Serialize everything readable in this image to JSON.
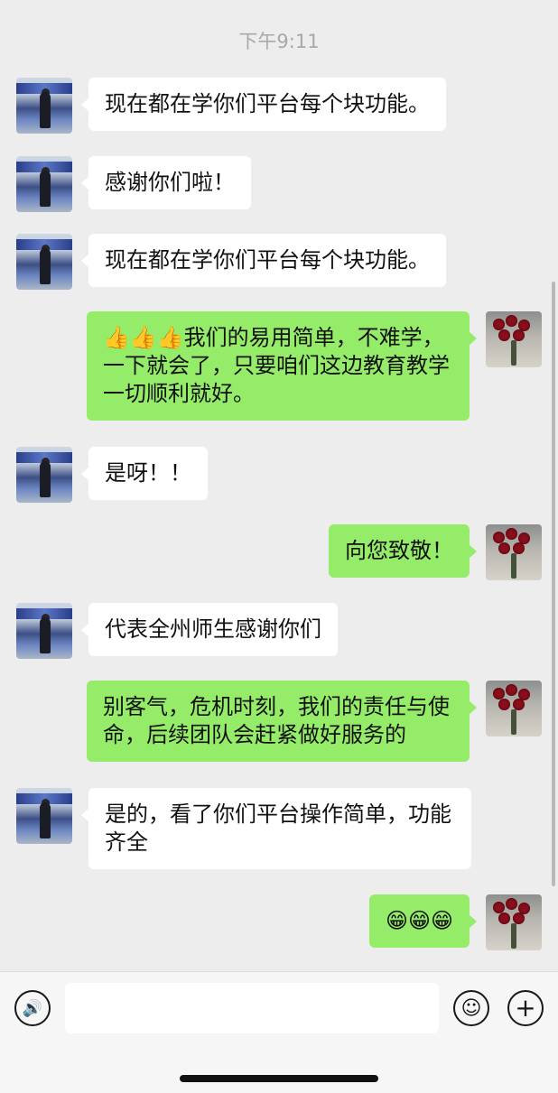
{
  "timestamp": "下午9:11",
  "messages": [
    {
      "side": "left",
      "text": "现在都在学你们平台每个块功能。"
    },
    {
      "side": "left",
      "text": "感谢你们啦！"
    },
    {
      "side": "left",
      "text": "现在都在学你们平台每个块功能。"
    },
    {
      "side": "right",
      "text": "👍👍👍我们的易用简单，不难学，一下就会了，只要咱们这边教育教学一切顺利就好。"
    },
    {
      "side": "left",
      "text": "是呀！！"
    },
    {
      "side": "right",
      "text": "向您致敬！"
    },
    {
      "side": "left",
      "text": "代表全州师生感谢你们"
    },
    {
      "side": "right",
      "text": "别客气，危机时刻，我们的责任与使命，后续团队会赶紧做好服务的"
    },
    {
      "side": "left",
      "text": "是的，看了你们平台操作简单，功能齐全"
    },
    {
      "side": "right",
      "text": "😁😁😁"
    }
  ],
  "input": {
    "voice_icon": "🔊",
    "emoji_icon": "☺",
    "plus_icon": "+",
    "placeholder": ""
  },
  "colors": {
    "background": "#ededed",
    "bubble_self": "#95ec69",
    "bubble_other": "#ffffff"
  }
}
